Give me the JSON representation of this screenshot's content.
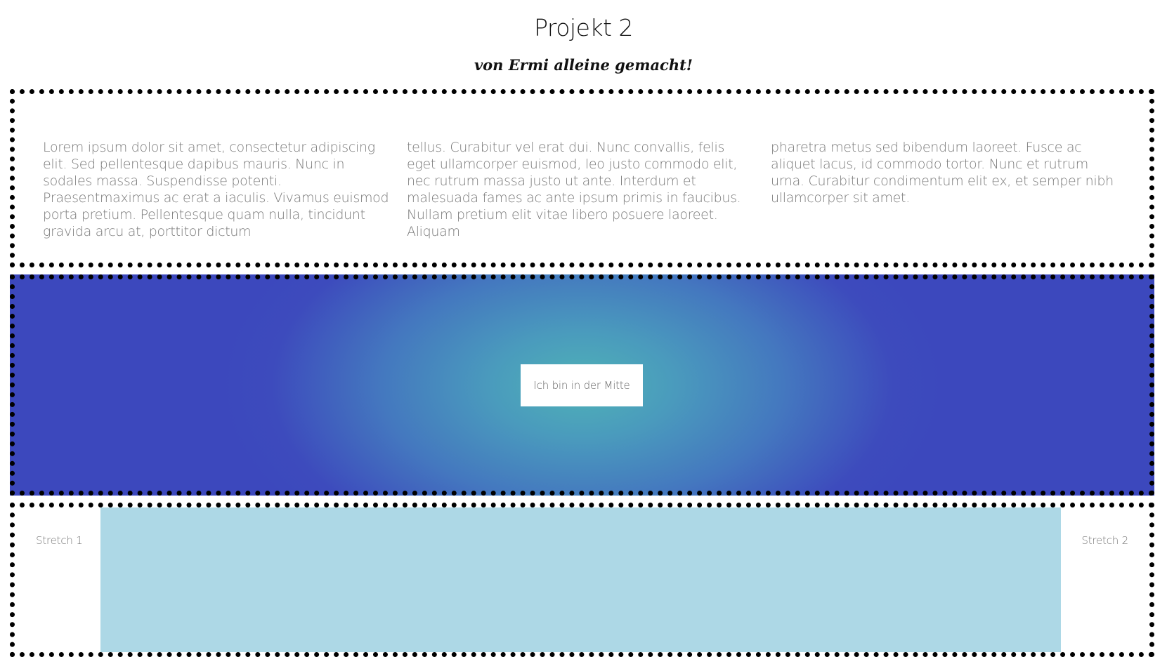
{
  "header": {
    "title": "Projekt 2",
    "subtitle": "von Ermi alleine gemacht!"
  },
  "text_section": {
    "columns": [
      "Lorem ipsum dolor sit amet, consectetur adipiscing elit. Sed pellentesque dapibus mauris. Nunc in sodales massa. Suspendisse potenti. Praesentmaximus ac erat a iaculis. Vivamus euismod porta pretium. Pellentesque quam nulla, tincidunt gravida arcu at, porttitor dictum",
      "tellus. Curabitur vel erat dui. Nunc convallis, felis eget ullamcorper euismod, leo justo commodo elit, nec rutrum massa justo ut ante. Interdum et malesuada fames ac ante ipsum primis in faucibus. Nullam pretium elit vitae libero posuere laoreet. Aliquam",
      "pharetra metus sed bibendum laoreet. Fusce ac aliquet lacus, id commodo tortor. Nunc et rutrum urna. Curabitur condimentum elit ex, et semper nibh ullamcorper sit amet."
    ]
  },
  "center_section": {
    "box_label": "Ich bin in der Mitte",
    "gradient_center_color": "#4fb2b6",
    "gradient_edge_color": "#3c48bd"
  },
  "stretch_section": {
    "left_label": "Stretch 1",
    "right_label": "Stretch 2",
    "fill_color": "#add8e6"
  }
}
